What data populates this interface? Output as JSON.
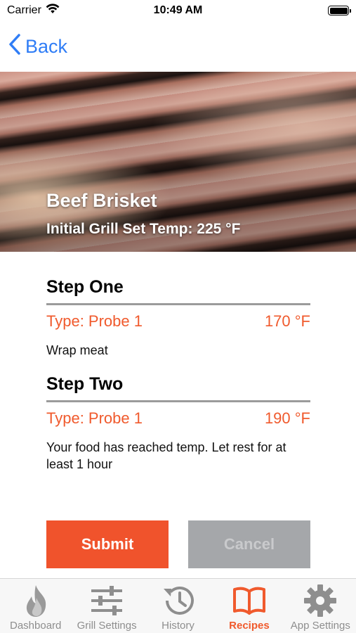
{
  "status_bar": {
    "carrier": "Carrier",
    "time": "10:49 AM"
  },
  "nav": {
    "back_label": "Back"
  },
  "hero": {
    "title": "Beef Brisket",
    "subtitle": "Initial Grill Set Temp: 225 °F"
  },
  "steps": [
    {
      "title": "Step One",
      "type": "Type: Probe 1",
      "temp": "170 °F",
      "note": "Wrap meat"
    },
    {
      "title": "Step Two",
      "type": "Type: Probe 1",
      "temp": "190 °F",
      "note": "Your food has reached temp. Let rest for at least 1 hour"
    }
  ],
  "actions": {
    "submit_label": "Submit",
    "cancel_label": "Cancel"
  },
  "tabs": [
    {
      "label": "Dashboard",
      "icon": "flame-icon"
    },
    {
      "label": "Grill Settings",
      "icon": "sliders-icon"
    },
    {
      "label": "History",
      "icon": "history-icon"
    },
    {
      "label": "Recipes",
      "icon": "book-icon"
    },
    {
      "label": "App Settings",
      "icon": "gear-icon"
    }
  ],
  "colors": {
    "accent": "#f05a2d",
    "link": "#2f7df6",
    "disabled": "#a5a7aa",
    "tab_inactive": "#8e8e8e"
  }
}
